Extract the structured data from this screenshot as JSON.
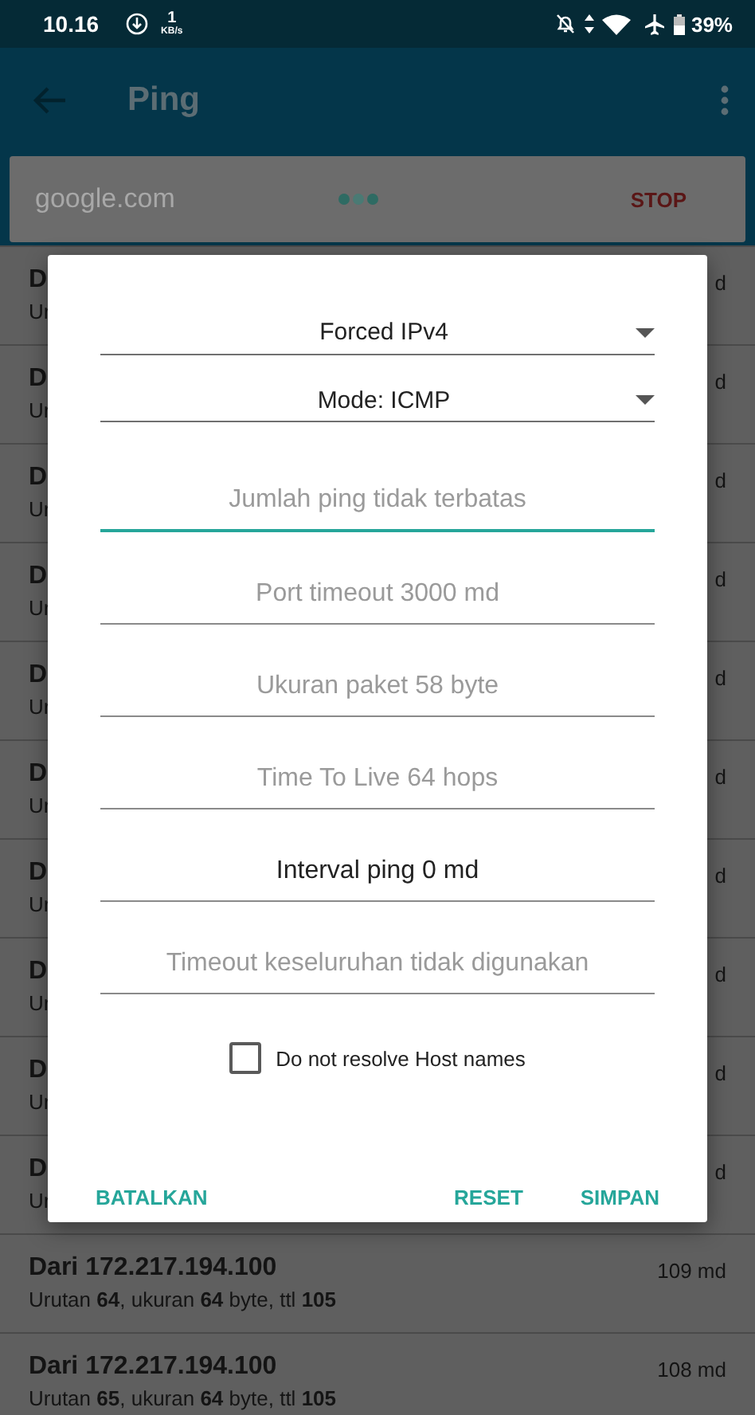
{
  "status_bar": {
    "time": "10.16",
    "speed_value": "1",
    "speed_unit": "KB/s",
    "battery": "39%"
  },
  "app_bar": {
    "title": "Ping"
  },
  "search": {
    "value": "google.com",
    "action": "STOP"
  },
  "results": [
    {
      "title": "D",
      "detail": "Ur",
      "time": "d"
    },
    {
      "title": "D",
      "detail": "Ur",
      "time": "d"
    },
    {
      "title": "D",
      "detail": "Ur",
      "time": "d"
    },
    {
      "title": "D",
      "detail": "Ur",
      "time": "d"
    },
    {
      "title": "D",
      "detail": "Ur",
      "time": "d"
    },
    {
      "title": "D",
      "detail": "Ur",
      "time": "d"
    },
    {
      "title": "D",
      "detail": "Ur",
      "time": "d"
    },
    {
      "title": "D",
      "detail": "Ur",
      "time": "d"
    },
    {
      "title": "D",
      "detail": "Ur",
      "time": "d"
    },
    {
      "title": "D",
      "detail": "Ur",
      "time": "d"
    },
    {
      "title": "Dari 172.217.194.100",
      "detail": "Urutan **64**, ukuran **64** byte, ttl **105**",
      "time": "109 md"
    },
    {
      "title": "Dari 172.217.194.100",
      "detail": "Urutan **65**, ukuran **64** byte, ttl **105**",
      "time": "108 md"
    }
  ],
  "dialog": {
    "spinners": [
      {
        "value": "Forced IPv4"
      },
      {
        "value": "Mode: ICMP"
      }
    ],
    "fields": [
      {
        "placeholder": "Jumlah ping tidak terbatas",
        "focused": true
      },
      {
        "placeholder": "Port timeout 3000 md",
        "focused": false
      },
      {
        "placeholder": "Ukuran paket 58 byte",
        "focused": false
      },
      {
        "placeholder": "Time To Live 64 hops",
        "focused": false
      },
      {
        "value": "Interval ping 0 md",
        "focused": false
      },
      {
        "placeholder": "Timeout keseluruhan tidak digunakan",
        "focused": false
      }
    ],
    "checkbox": {
      "label": "Do not resolve Host names",
      "checked": false
    },
    "buttons": [
      {
        "label": "BATALKAN"
      },
      {
        "label": "RESET"
      },
      {
        "label": "SIMPAN"
      }
    ]
  }
}
